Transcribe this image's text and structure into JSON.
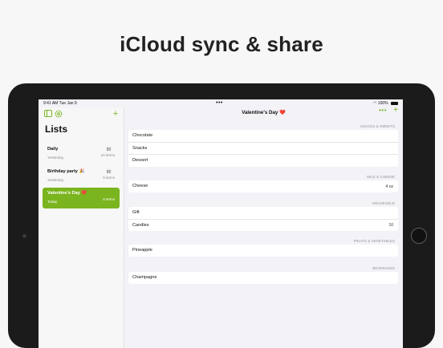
{
  "headline": "iCloud sync & share",
  "status": {
    "time_date": "9:41 AM   Tue Jan 9",
    "dots": "•••",
    "battery": "100%"
  },
  "sidebar": {
    "title": "Lists",
    "lists": [
      {
        "name": "Daily",
        "date": "Yesterday",
        "count": "10 items",
        "shared": true,
        "selected": false
      },
      {
        "name": "Birthday party 🎉",
        "date": "Yesterday",
        "count": "6 items",
        "shared": true,
        "selected": false
      },
      {
        "name": "Valentine's Day ❤️",
        "date": "Today",
        "count": "8 items",
        "shared": false,
        "selected": true
      }
    ]
  },
  "main": {
    "title": "Valentine's Day ❤️",
    "sections": [
      {
        "label": "SNACKS & SWEETS",
        "items": [
          {
            "name": "Chocolate",
            "qty": ""
          },
          {
            "name": "Snacks",
            "qty": ""
          },
          {
            "name": "Dessert",
            "qty": ""
          }
        ]
      },
      {
        "label": "MILK & CHEESE",
        "items": [
          {
            "name": "Cheese",
            "qty": "4 oz"
          }
        ]
      },
      {
        "label": "HOUSEHOLD",
        "items": [
          {
            "name": "Gift",
            "qty": ""
          },
          {
            "name": "Candles",
            "qty": "10"
          }
        ]
      },
      {
        "label": "FRUITS & VEGETABLES",
        "items": [
          {
            "name": "Pineapple",
            "qty": ""
          }
        ]
      },
      {
        "label": "BEVERAGES",
        "items": [
          {
            "name": "Champagne",
            "qty": ""
          }
        ]
      }
    ]
  },
  "colors": {
    "accent": "#7bb323",
    "selected": "#7ab41e"
  }
}
